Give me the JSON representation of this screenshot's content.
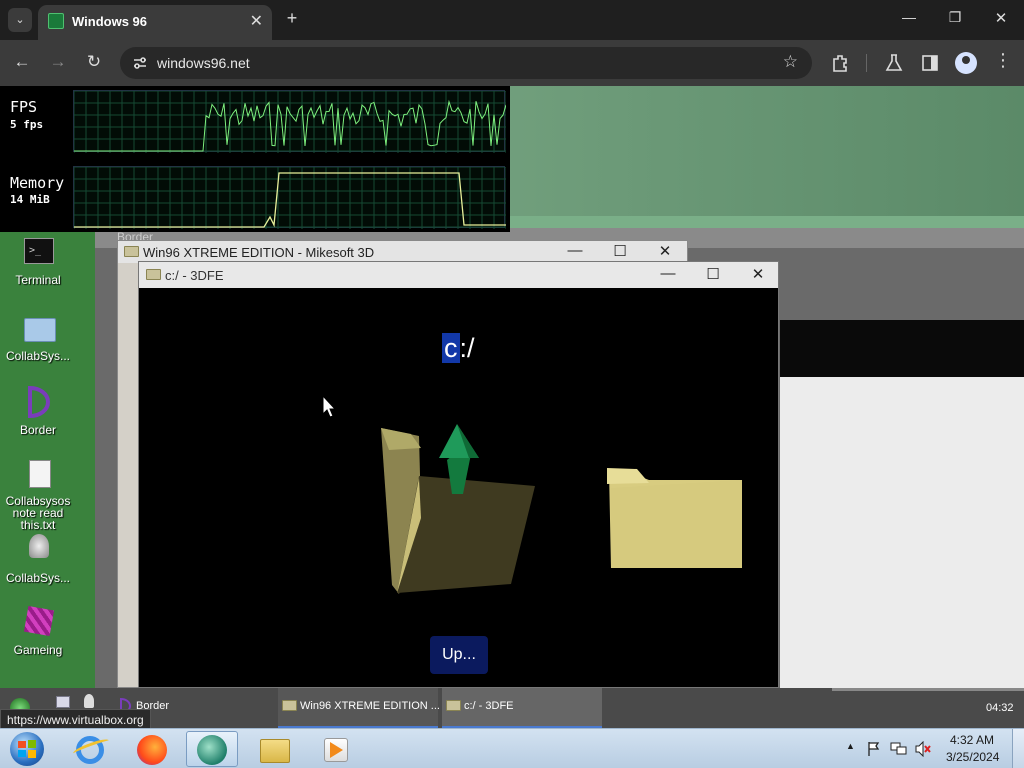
{
  "browser": {
    "tab_title": "Windows 96",
    "tab_close": "✕",
    "new_tab": "+",
    "url": "windows96.net",
    "window_controls": {
      "minimize": "—",
      "maximize": "❐",
      "close": "✕"
    },
    "nav": {
      "back": "←",
      "forward": "→",
      "reload": "↻"
    },
    "icons": [
      "tab-search-icon",
      "favicon-icon",
      "site-info-icon",
      "star-icon",
      "extensions-icon",
      "labs-icon",
      "side-panel-icon",
      "profile-icon",
      "menu-icon"
    ]
  },
  "perf": {
    "fps_label": "FPS",
    "fps_value": "5 fps",
    "mem_label": "Memory",
    "mem_value": "14 MiB"
  },
  "desktop_icons": [
    {
      "label": "Terminal",
      "icon": "terminal-icon"
    },
    {
      "label": "CollabSys...",
      "icon": "folder-icon"
    },
    {
      "label": "Border",
      "icon": "border-app-icon"
    },
    {
      "label": "Collabsysos note read this.txt",
      "icon": "text-file-icon"
    },
    {
      "label": "CollabSys...",
      "icon": "collabsys-app-icon"
    },
    {
      "label": "Gameing",
      "icon": "gameing-cube-icon"
    }
  ],
  "bg_window": {
    "title": "Border"
  },
  "win_3d": {
    "title": "Win96 XTREME EDITION - Mikesoft 3D"
  },
  "win_fe": {
    "title": "c:/ - 3DFE",
    "path_highlight": "c",
    "path_rest": ":/",
    "up_label": "Up..."
  },
  "taskbar96": {
    "items": [
      "Border",
      "Win96 XTREME EDITION ...",
      "c:/ - 3DFE"
    ],
    "time": "04:32"
  },
  "status_url": "https://www.virtualbox.org",
  "win7": {
    "time": "4:32 AM",
    "date": "3/25/2024",
    "tray_up": "▲"
  },
  "colors": {
    "desktop": "#2e7a3a",
    "fps_graph": "#7ef07e",
    "mem_graph": "#e8f09a",
    "folder": "#d8cc80",
    "arrow": "#1f9a5a"
  }
}
